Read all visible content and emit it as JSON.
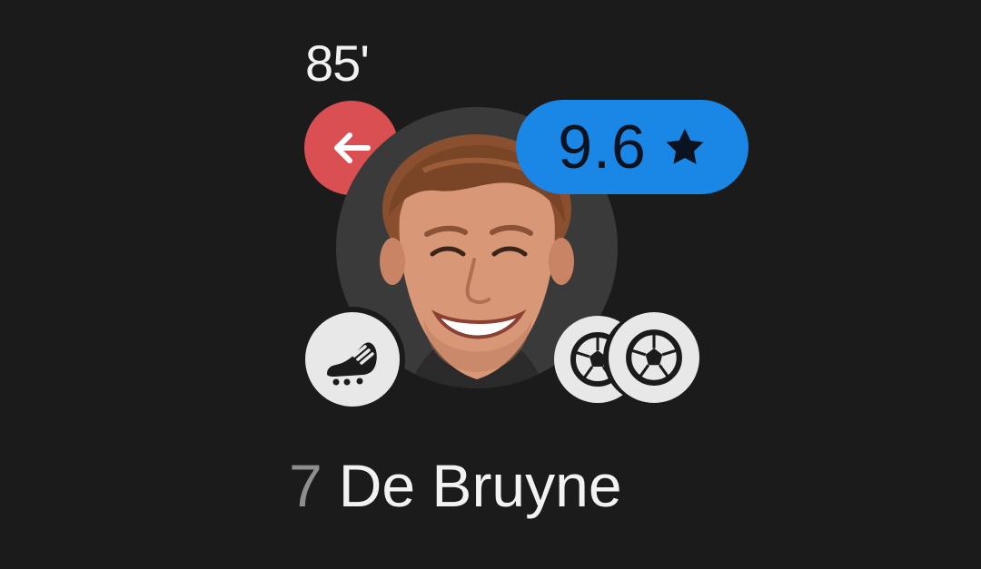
{
  "player": {
    "shirt_number": "7",
    "name": "De Bruyne",
    "rating": "9.6",
    "sub_off_minute": "85'"
  },
  "icons": {
    "sub_off": "arrow-left-icon",
    "rating": "star-icon",
    "assist": "football-boot-icon",
    "goals": [
      "football-icon",
      "football-icon"
    ]
  },
  "colors": {
    "background": "#1b1b1b",
    "sub_off": "#da4f52",
    "rating_badge": "#1a86e5",
    "badge_light": "#e8e8e8"
  }
}
